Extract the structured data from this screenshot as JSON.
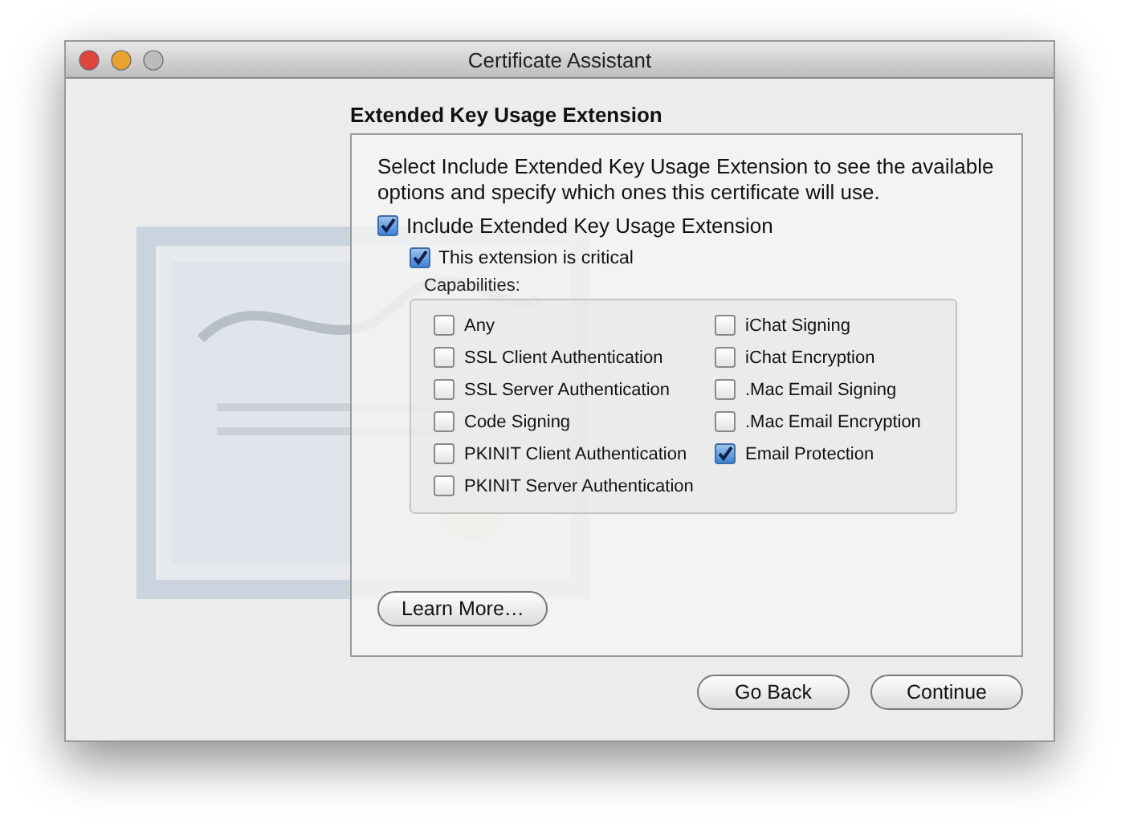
{
  "window": {
    "title": "Certificate Assistant"
  },
  "heading": "Extended Key Usage Extension",
  "description": "Select Include Extended Key Usage Extension to see the available options and specify which ones this certificate will use.",
  "include": {
    "label": "Include Extended Key Usage Extension",
    "checked": true
  },
  "critical": {
    "label": "This extension is critical",
    "checked": true
  },
  "capabilities": {
    "label": "Capabilities:",
    "columns": [
      [
        {
          "label": "Any",
          "checked": false
        },
        {
          "label": "SSL Client Authentication",
          "checked": false
        },
        {
          "label": "SSL Server Authentication",
          "checked": false
        },
        {
          "label": "Code Signing",
          "checked": false
        },
        {
          "label": "PKINIT Client Authentication",
          "checked": false
        },
        {
          "label": "PKINIT Server Authentication",
          "checked": false
        }
      ],
      [
        {
          "label": "iChat Signing",
          "checked": false
        },
        {
          "label": "iChat Encryption",
          "checked": false
        },
        {
          "label": ".Mac Email Signing",
          "checked": false
        },
        {
          "label": ".Mac Email Encryption",
          "checked": false
        },
        {
          "label": "Email Protection",
          "checked": true
        }
      ]
    ]
  },
  "learn_more": "Learn More…",
  "buttons": [
    {
      "label": "Go Back"
    },
    {
      "label": "Continue"
    }
  ]
}
